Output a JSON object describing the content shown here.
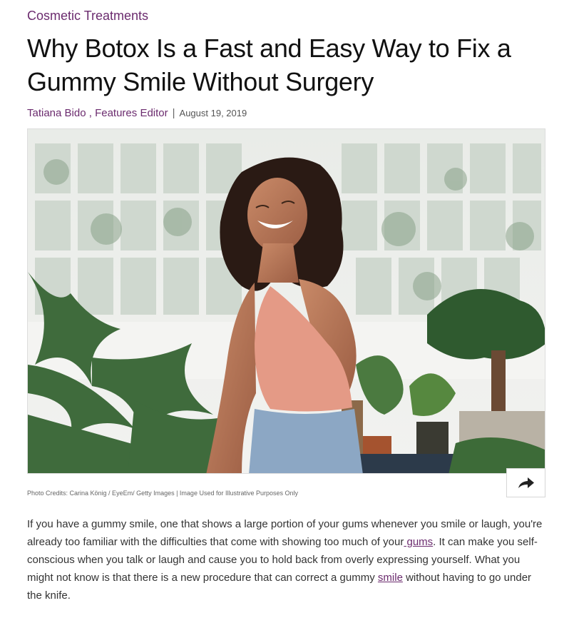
{
  "article": {
    "category": "Cosmetic Treatments",
    "title": "Why Botox Is a Fast and Easy Way to Fix a Gummy Smile Without Surgery",
    "author": "Tatiana Bido",
    "author_separator": " , ",
    "author_role": "Features Editor",
    "byline_divider": "|",
    "date": "August 19, 2019",
    "photo_credits": "Photo Credits: Carina König / EyeEm/ Getty Images | Image Used for Illustrative Purposes Only",
    "body": {
      "part1": "If you have a gummy smile, one that shows a large portion of your gums whenever you smile or laugh, you're already too familiar with the difficulties that come with showing too much of your",
      "link1": " gums",
      "part2": ". It can make you self-conscious when you talk or laugh and cause you to hold back from overly expressing yourself. What you might not know is that there is a new procedure that can correct a gummy ",
      "link2": "smile",
      "part3": " without having to go under the knife."
    }
  },
  "share_button": {
    "icon": "share-arrow-icon"
  },
  "colors": {
    "accent": "#6b2b6e",
    "text": "#333333",
    "title": "#111111"
  }
}
